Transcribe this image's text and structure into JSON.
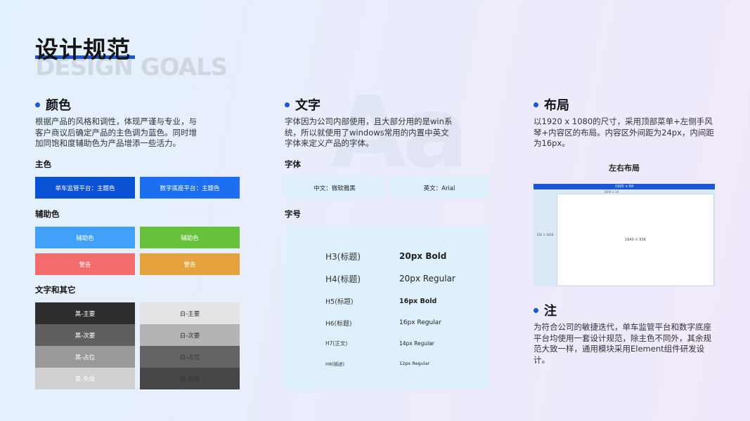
{
  "header": {
    "title": "设计规范",
    "subtitle": "DESIGN GOALS",
    "watermark": "Aa"
  },
  "color": {
    "heading": "颜色",
    "description": "根据产品的风格和调性，体现严谨与专业，与客户商议后确定产品的主色调为蓝色。同时增加同饱和度辅助色为产品增添一些活力。",
    "primary_label": "主色",
    "primary": [
      {
        "label": "单车监管平台：主题色",
        "color": "#0a52d4"
      },
      {
        "label": "数字底座平台：主题色",
        "color": "#1c6ff0"
      }
    ],
    "aux_label": "辅助色",
    "aux": [
      {
        "label": "辅助色",
        "color": "#41a0f8"
      },
      {
        "label": "辅助色",
        "color": "#67c13b"
      },
      {
        "label": "警告",
        "color": "#f56c6c"
      },
      {
        "label": "警告",
        "color": "#e6a23c"
      }
    ],
    "text_label": "文字和其它",
    "text_black": [
      {
        "label": "黑-主要",
        "color": "#2e2e2e"
      },
      {
        "label": "黑-次要",
        "color": "#5f5f5f"
      },
      {
        "label": "黑-占位",
        "color": "#999999"
      },
      {
        "label": "黑-失效",
        "color": "#d0d0d0"
      }
    ],
    "text_white": [
      {
        "label": "白-主要",
        "color": "#e3e3e3"
      },
      {
        "label": "白-次要",
        "color": "#b4b4b4"
      },
      {
        "label": "白-占位",
        "color": "#646464"
      },
      {
        "label": "白-失效",
        "color": "#474747"
      }
    ]
  },
  "text": {
    "heading": "文字",
    "description": "字体因为公司内部使用，且大部分用的是win系统，所以就使用了windows常用的内置中英文字体来定义产品的字体。",
    "font_label": "字体",
    "fonts": [
      "中文：微软雅黑",
      "英文：Arial"
    ],
    "size_label": "字号",
    "sizes": [
      {
        "name": "H3(标题)",
        "value": "20px Bold"
      },
      {
        "name": "H4(标题)",
        "value": "20px Regular"
      },
      {
        "name": "H5(标题)",
        "value": "16px Bold"
      },
      {
        "name": "H6(标题)",
        "value": "16px Regular"
      },
      {
        "name": "H7(正文)",
        "value": "14px Regular"
      },
      {
        "name": "H8(描述)",
        "value": "12px Regular"
      }
    ]
  },
  "layout": {
    "heading": "布局",
    "description": "以1920 x 1080的尺寸，采用顶部菜单+左侧手风琴+内容区的布局。内容区外间距为24px，内间距为16px。",
    "diagram_title": "左右布局",
    "top_bar": "1920 × 64",
    "inner_spacing": "1600 × 24",
    "side": "232 × 1016",
    "main": "1640 × 936"
  },
  "note": {
    "heading": "注",
    "description": "为符合公司的敏捷迭代，单车监管平台和数字底座平台均使用一套设计规范，除主色不同外，其余规范大致一样，通用模块采用Element组件研发设计。"
  }
}
